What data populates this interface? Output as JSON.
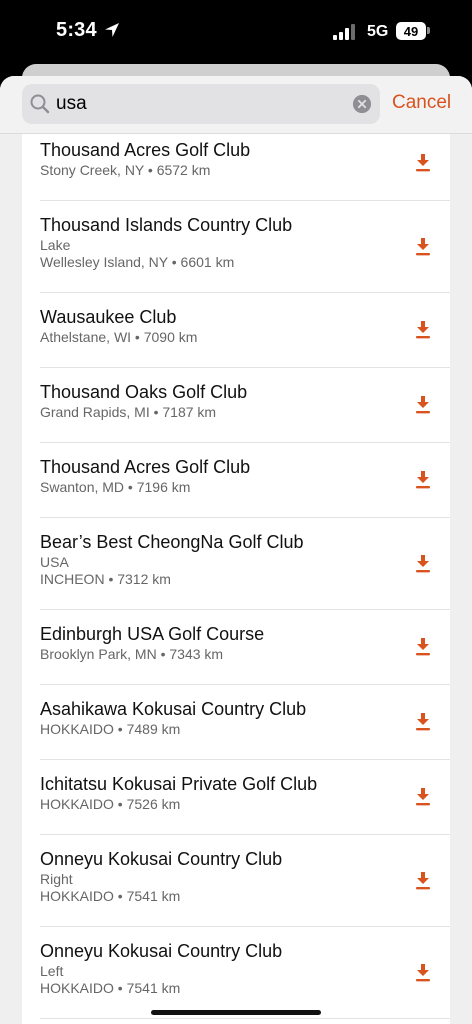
{
  "status": {
    "time": "5:34",
    "network": "5G",
    "battery": "49"
  },
  "search": {
    "value": "usa",
    "placeholder": "Search",
    "cancel_label": "Cancel"
  },
  "colors": {
    "accent": "#d9531e"
  },
  "results": [
    {
      "name": "Thousand Acres Golf Club",
      "lines": [
        "Stony Creek, NY • 6572 km"
      ]
    },
    {
      "name": "Thousand Islands Country Club",
      "lines": [
        "Lake",
        "Wellesley Island, NY • 6601 km"
      ]
    },
    {
      "name": "Wausaukee Club",
      "lines": [
        "Athelstane, WI • 7090 km"
      ]
    },
    {
      "name": "Thousand Oaks Golf Club",
      "lines": [
        "Grand Rapids, MI • 7187 km"
      ]
    },
    {
      "name": "Thousand Acres Golf Club",
      "lines": [
        "Swanton, MD • 7196 km"
      ]
    },
    {
      "name": "Bear’s Best CheongNa Golf Club",
      "lines": [
        "USA",
        "INCHEON • 7312 km"
      ]
    },
    {
      "name": "Edinburgh USA Golf Course",
      "lines": [
        "Brooklyn Park, MN • 7343 km"
      ]
    },
    {
      "name": "Asahikawa Kokusai Country Club",
      "lines": [
        "HOKKAIDO • 7489 km"
      ]
    },
    {
      "name": "Ichitatsu Kokusai Private Golf Club",
      "lines": [
        "HOKKAIDO • 7526 km"
      ]
    },
    {
      "name": "Onneyu Kokusai Country Club",
      "lines": [
        "Right",
        "HOKKAIDO • 7541 km"
      ]
    },
    {
      "name": "Onneyu Kokusai Country Club",
      "lines": [
        "Left",
        "HOKKAIDO • 7541 km"
      ]
    }
  ]
}
